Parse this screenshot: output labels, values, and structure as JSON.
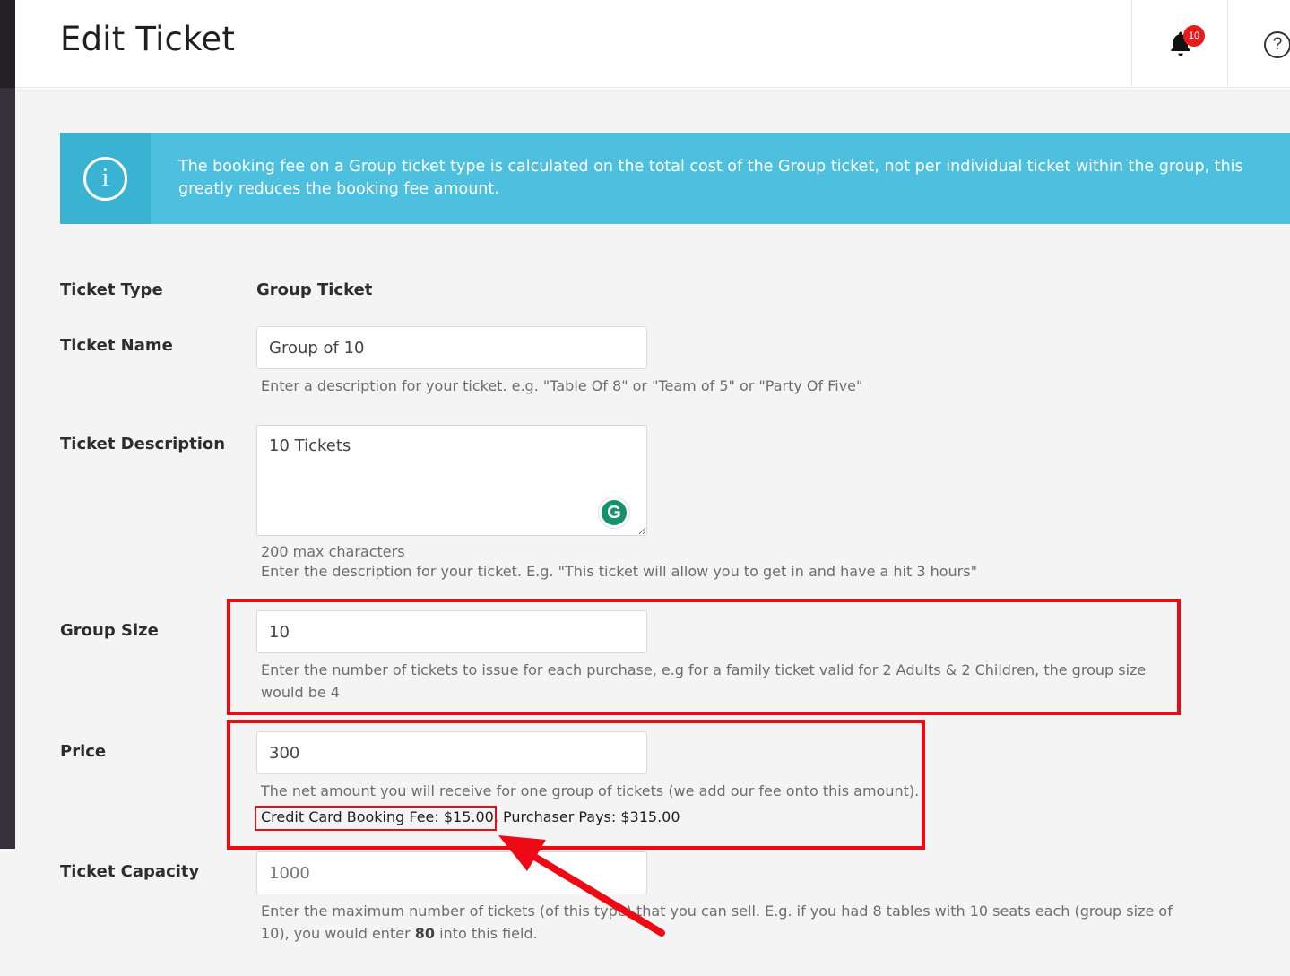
{
  "header": {
    "title": "Edit Ticket",
    "notifications_count": "10",
    "help_icon_label": "?"
  },
  "alert": {
    "icon_label": "i",
    "message": "The booking fee on a Group ticket type is calculated on the total cost of the Group ticket, not per individual ticket within the group, this greatly reduces the booking fee amount."
  },
  "form": {
    "ticket_type": {
      "label": "Ticket Type",
      "value": "Group Ticket"
    },
    "ticket_name": {
      "label": "Ticket Name",
      "value": "Group of 10",
      "help": "Enter a description for your ticket. e.g. \"Table Of 8\" or \"Team of 5\" or \"Party Of Five\""
    },
    "ticket_description": {
      "label": "Ticket Description",
      "value": "10 Tickets",
      "max_chars": "200 max characters",
      "help": "Enter the description for your ticket. E.g. \"This ticket will allow you to get in and have a hit 3 hours\""
    },
    "group_size": {
      "label": "Group Size",
      "value": "10",
      "help": "Enter the number of tickets to issue for each purchase, e.g for a family ticket valid for 2 Adults & 2 Children, the group size would be 4"
    },
    "price": {
      "label": "Price",
      "value": "300",
      "help": "The net amount you will receive for one group of tickets (we add our fee onto this amount).",
      "booking_fee": "Credit Card Booking Fee: $15.00,",
      "purchaser_pays": "Purchaser Pays: $315.00"
    },
    "ticket_capacity": {
      "label": "Ticket Capacity",
      "placeholder": "1000",
      "help_before": "Enter the maximum number of tickets (of this type) that you can sell. E.g. if you had 8 tables with 10 seats each (group size of 10), you would enter ",
      "help_bold": "80",
      "help_after": " into this field."
    }
  },
  "grammarly": {
    "icon": "grammarly-icon",
    "letter": "G"
  },
  "colors": {
    "alert_bg": "#4cc0de",
    "alert_icon_bg": "#3ab2d2",
    "annotation_red": "#ee0a15",
    "badge_red": "#e41e1e"
  }
}
